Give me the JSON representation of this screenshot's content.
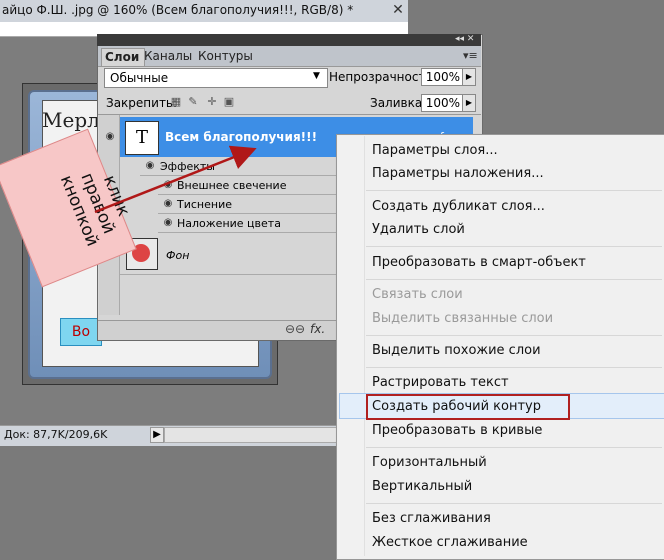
{
  "document": {
    "title": "айцо Ф.Ш. .jpg @ 160% (Всем благополучия!!!, RGB/8) *",
    "close_icon": "close-icon",
    "canvas_text": "Мерл",
    "canvas_button_text": "Во",
    "status_text": "Док: 87,7K/209,6K"
  },
  "annotation": {
    "text": "клик правой кнопкой"
  },
  "layers_panel": {
    "tabs": [
      "Слои",
      "Каналы",
      "Контуры"
    ],
    "blend_mode": "Обычные",
    "opacity_label": "Непрозрачность:",
    "opacity_value": "100%",
    "lock_label": "Закрепить:",
    "fill_label": "Заливка:",
    "fill_value": "100%",
    "layers": {
      "text_layer": {
        "thumb": "T",
        "name": "Всем благополучия!!!"
      },
      "effects_label": "Эффекты",
      "effects": [
        "Внешнее свечение",
        "Тиснение",
        "Наложение цвета"
      ],
      "background": {
        "name": "Фон"
      }
    },
    "bottom": {
      "link": "⊖⊖",
      "fx": "fx."
    }
  },
  "context_menu": {
    "groups": [
      [
        {
          "label": "Параметры слоя...",
          "enabled": true
        },
        {
          "label": "Параметры наложения...",
          "enabled": true
        }
      ],
      [
        {
          "label": "Создать дубликат слоя...",
          "enabled": true
        },
        {
          "label": "Удалить слой",
          "enabled": true
        }
      ],
      [
        {
          "label": "Преобразовать в смарт-объект",
          "enabled": true
        }
      ],
      [
        {
          "label": "Связать слои",
          "enabled": false
        },
        {
          "label": "Выделить связанные слои",
          "enabled": false
        }
      ],
      [
        {
          "label": "Выделить похожие слои",
          "enabled": true
        }
      ],
      [
        {
          "label": "Растрировать текст",
          "enabled": true
        },
        {
          "label": "Создать рабочий контур",
          "enabled": true,
          "highlighted": true
        },
        {
          "label": "Преобразовать в кривые",
          "enabled": true
        }
      ],
      [
        {
          "label": "Горизонтальный",
          "enabled": true
        },
        {
          "label": "Вертикальный",
          "enabled": true
        }
      ],
      [
        {
          "label": "Без сглаживания",
          "enabled": true
        },
        {
          "label": "Жесткое сглаживание",
          "enabled": true
        }
      ]
    ]
  },
  "colors": {
    "selection_blue": "#3d8ee6",
    "highlight_border": "#b02020",
    "annotation_bg": "#f7c7c7",
    "arrow": "#b01818"
  }
}
